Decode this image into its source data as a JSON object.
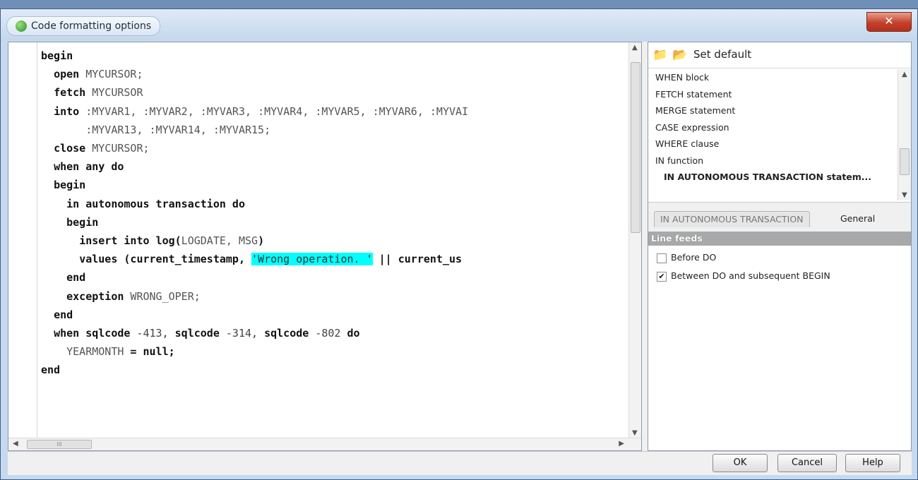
{
  "window": {
    "title": "Code formatting options",
    "close_glyph": "✕"
  },
  "editor": {
    "lines": [
      [
        {
          "t": "begin",
          "c": "kw"
        }
      ],
      [
        {
          "t": "  "
        },
        {
          "t": "open",
          "c": "kw"
        },
        {
          "t": " MYCURSOR;",
          "c": "id"
        }
      ],
      [
        {
          "t": "  "
        },
        {
          "t": "fetch",
          "c": "kw"
        },
        {
          "t": " MYCURSOR",
          "c": "id"
        }
      ],
      [
        {
          "t": "  "
        },
        {
          "t": "into",
          "c": "kw"
        },
        {
          "t": " :MYVAR1, :MYVAR2, :MYVAR3, :MYVAR4, :MYVAR5, :MYVAR6, :MYVAI",
          "c": "id"
        }
      ],
      [
        {
          "t": "       :MYVAR13, :MYVAR14, :MYVAR15;",
          "c": "id"
        }
      ],
      [
        {
          "t": "  "
        },
        {
          "t": "close",
          "c": "kw"
        },
        {
          "t": " MYCURSOR;",
          "c": "id"
        }
      ],
      [
        {
          "t": ""
        }
      ],
      [
        {
          "t": "  "
        },
        {
          "t": "when any do",
          "c": "kw"
        }
      ],
      [
        {
          "t": "  "
        },
        {
          "t": "begin",
          "c": "kw"
        }
      ],
      [
        {
          "t": "    "
        },
        {
          "t": "in autonomous transaction do",
          "c": "kw"
        }
      ],
      [
        {
          "t": "    "
        },
        {
          "t": "begin",
          "c": "kw"
        }
      ],
      [
        {
          "t": "      "
        },
        {
          "t": "insert into",
          "c": "kw"
        },
        {
          "t": " "
        },
        {
          "t": "log(",
          "c": "kw"
        },
        {
          "t": "LOGDATE, MSG",
          "c": "id"
        },
        {
          "t": ")",
          "c": "kw"
        }
      ],
      [
        {
          "t": "      "
        },
        {
          "t": "values (current_timestamp,",
          "c": "kw"
        },
        {
          "t": " "
        },
        {
          "t": "'Wrong operation. '",
          "c": "hl"
        },
        {
          "t": " || current_us",
          "c": "kw"
        }
      ],
      [
        {
          "t": "    "
        },
        {
          "t": "end",
          "c": "kw"
        }
      ],
      [
        {
          "t": "    "
        },
        {
          "t": "exception",
          "c": "kw"
        },
        {
          "t": " WRONG_OPER;",
          "c": "id"
        }
      ],
      [
        {
          "t": "  "
        },
        {
          "t": "end",
          "c": "kw"
        }
      ],
      [
        {
          "t": ""
        }
      ],
      [
        {
          "t": "  "
        },
        {
          "t": "when sqlcode",
          "c": "kw"
        },
        {
          "t": " -413",
          "c": "num"
        },
        {
          "t": ", "
        },
        {
          "t": "sqlcode",
          "c": "kw"
        },
        {
          "t": " -314",
          "c": "num"
        },
        {
          "t": ", "
        },
        {
          "t": "sqlcode",
          "c": "kw"
        },
        {
          "t": " -802",
          "c": "num"
        },
        {
          "t": " do",
          "c": "kw"
        }
      ],
      [
        {
          "t": "    "
        },
        {
          "t": "YEARMONTH",
          "c": "id"
        },
        {
          "t": " = null;",
          "c": "kw"
        }
      ],
      [
        {
          "t": "end",
          "c": "kw"
        }
      ]
    ],
    "hscroll_grip": "III"
  },
  "right_panel": {
    "set_default_label": "Set default",
    "items": [
      "WHEN block",
      "FETCH statement",
      "MERGE statement",
      "CASE expression",
      "WHERE clause",
      "IN function",
      "IN AUTONOMOUS TRANSACTION statem..."
    ],
    "selected_index": 6,
    "tabs": [
      "IN AUTONOMOUS TRANSACTION",
      "General"
    ],
    "section_title": "Line feeds",
    "options": [
      {
        "label": "Before DO",
        "checked": false
      },
      {
        "label": "Between DO and subsequent BEGIN",
        "checked": true
      }
    ]
  },
  "buttons": {
    "ok": "OK",
    "cancel": "Cancel",
    "help": "Help"
  },
  "colors": {
    "highlight": "#00ffff",
    "title_bar": "#c7d9ee",
    "close_button": "#c4402a"
  }
}
